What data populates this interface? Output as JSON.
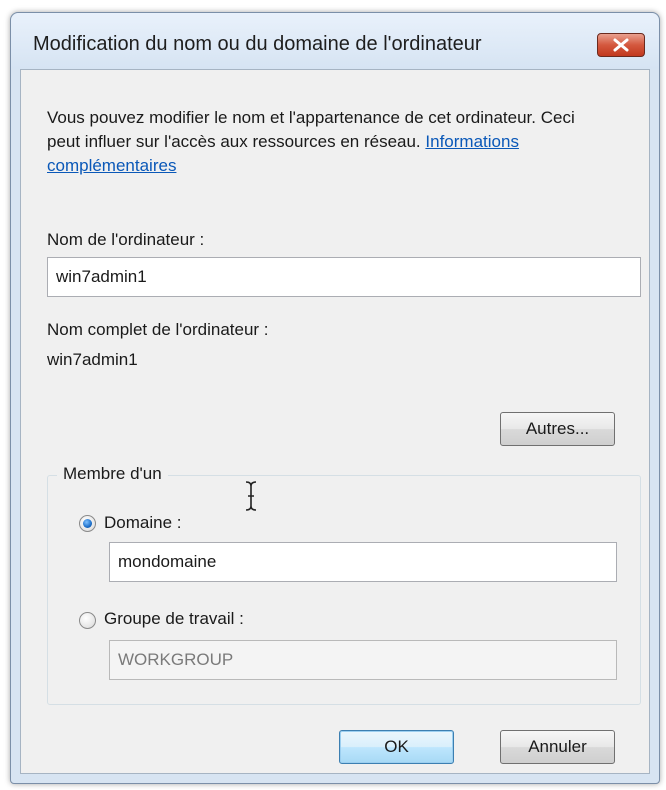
{
  "window": {
    "title": "Modification du nom ou du domaine de l'ordinateur"
  },
  "intro": {
    "text": "Vous pouvez modifier le nom et l'appartenance de cet ordinateur. Ceci peut influer sur l'accès aux ressources en réseau.",
    "link": "Informations complémentaires"
  },
  "computer_name": {
    "label": "Nom de l'ordinateur :",
    "value": "win7admin1"
  },
  "full_name": {
    "label": "Nom complet de l'ordinateur :",
    "value": "win7admin1"
  },
  "buttons": {
    "more": "Autres...",
    "ok": "OK",
    "cancel": "Annuler"
  },
  "membership": {
    "legend": "Membre d'un",
    "domain_label": "Domaine :",
    "domain_value": "mondomaine",
    "domain_selected": true,
    "workgroup_label": "Groupe de travail :",
    "workgroup_value": "WORKGROUP"
  },
  "icons": {
    "close": "close-icon",
    "text_cursor": "text-cursor-icon"
  }
}
